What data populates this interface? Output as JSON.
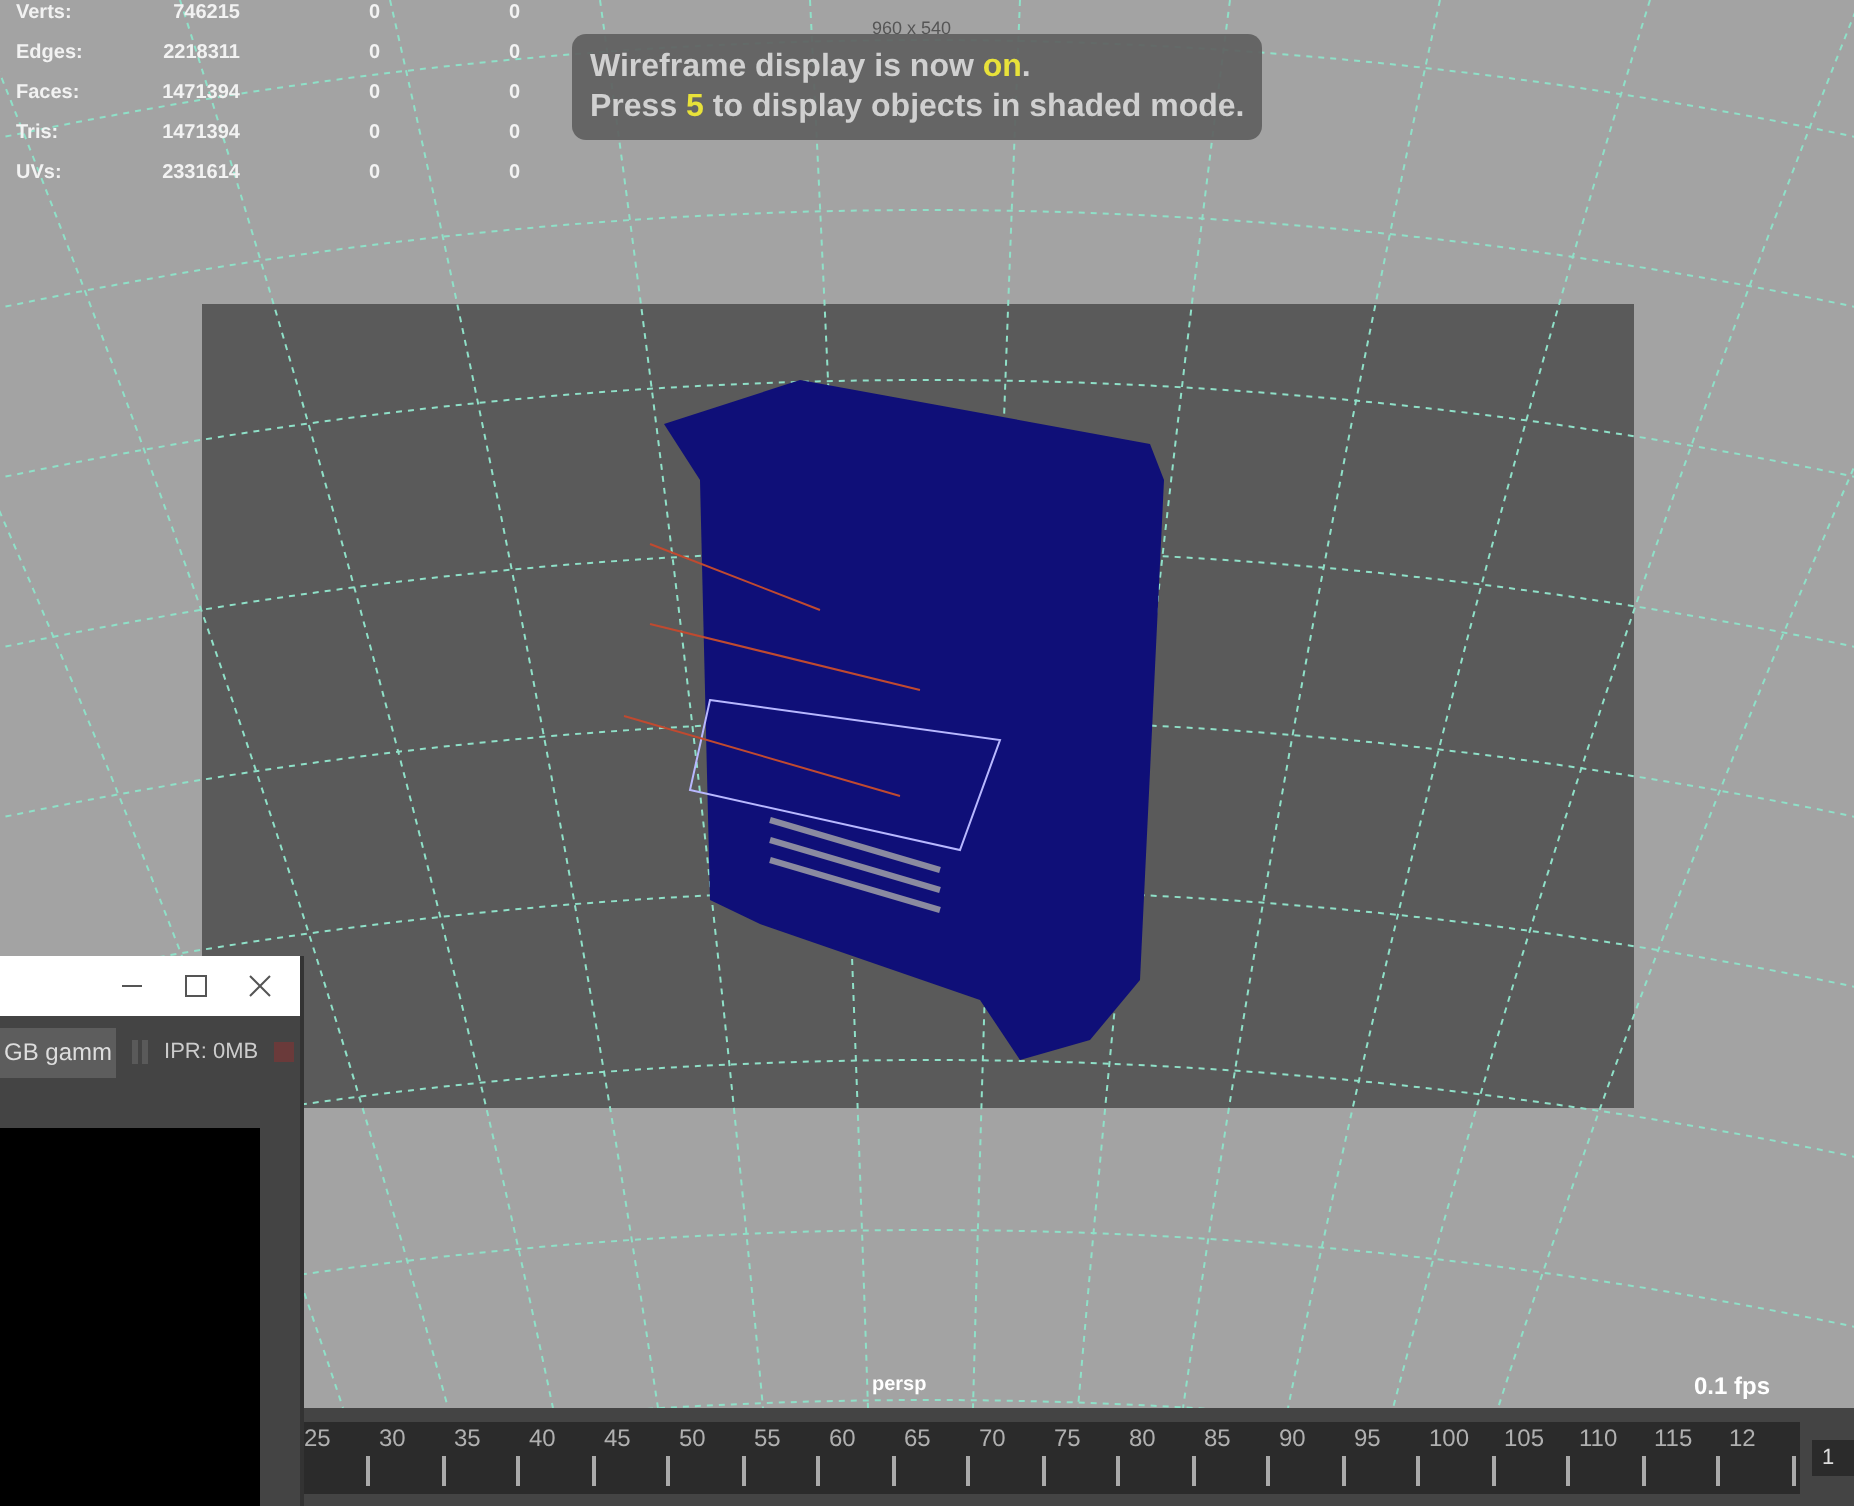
{
  "hud_stats": [
    {
      "label": "Verts:",
      "value": "746215",
      "column_3": "0",
      "column_4": "0"
    },
    {
      "label": "Edges:",
      "value": "2218311",
      "column_3": "0",
      "column_4": "0"
    },
    {
      "label": "Faces:",
      "value": "1471394",
      "column_3": "0",
      "column_4": "0"
    },
    {
      "label": "Tris:",
      "value": "1471394",
      "column_3": "0",
      "column_4": "0"
    },
    {
      "label": "UVs:",
      "value": "2331614",
      "column_3": "0",
      "column_4": "0"
    }
  ],
  "resolution_label": "960 x 540",
  "message": {
    "line_1": "Wireframe display is now **on**.",
    "line_2": "Press **5** to display objects in shaded mode."
  },
  "viewport": {
    "camera": "persp",
    "fps": "0.1 fps"
  },
  "timeline": {
    "ticks": [
      "25",
      "30",
      "35",
      "40",
      "45",
      "50",
      "55",
      "60",
      "65",
      "70",
      "75",
      "80",
      "85",
      "90",
      "95",
      "100",
      "105",
      "110",
      "115",
      "12"
    ],
    "current_frame": "1"
  },
  "render_window": {
    "color_space": "GB gamm",
    "ipr": "IPR: 0MB"
  }
}
